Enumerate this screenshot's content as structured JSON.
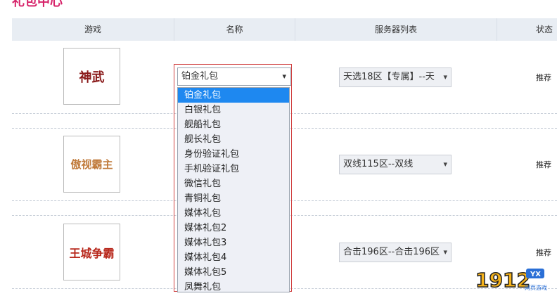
{
  "page": {
    "title": "礼包中心"
  },
  "table": {
    "headers": [
      "游戏",
      "名称",
      "服务器列表",
      "状态"
    ],
    "rows": [
      {
        "game_logo": "神武",
        "server": "天选18区【专属】--天",
        "status": "推荐"
      },
      {
        "game_logo": "傲视霸主",
        "server": "双线115区--双线",
        "status": "推荐"
      },
      {
        "game_logo": "王城争霸",
        "server": "合击196区--合击196区",
        "status": "推荐"
      }
    ]
  },
  "gift_select": {
    "selected": "铂金礼包",
    "options": [
      "铂金礼包",
      "白银礼包",
      "舰船礼包",
      "舰长礼包",
      "身份验证礼包",
      "手机验证礼包",
      "微信礼包",
      "青铜礼包",
      "媒体礼包",
      "媒体礼包2",
      "媒体礼包3",
      "媒体礼包4",
      "媒体礼包5",
      "凤舞礼包"
    ]
  },
  "watermark": {
    "number": "1912",
    "badge": "YX",
    "sub": "网页游戏"
  },
  "colors": {
    "header_bg": "#e8edf3",
    "highlight": "#1e88f0",
    "title": "#d6246a",
    "frame": "#d04040"
  }
}
